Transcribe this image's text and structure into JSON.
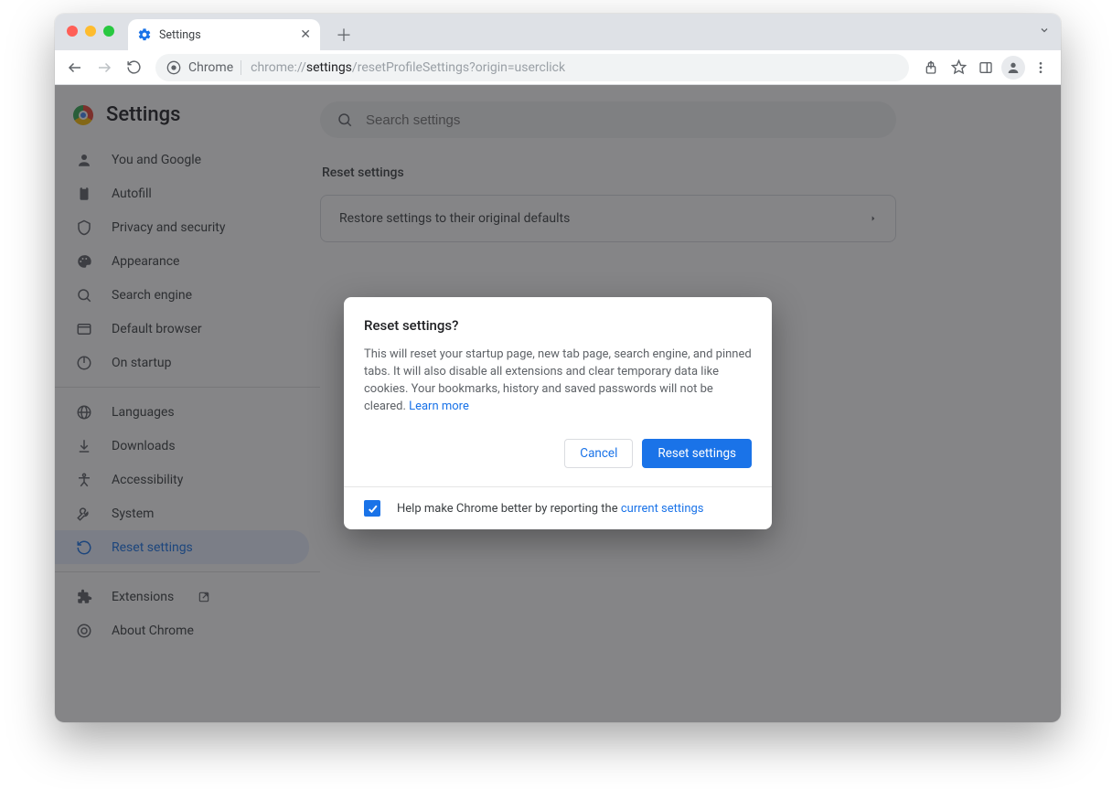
{
  "browser": {
    "tab_title": "Settings",
    "url_prefix": "Chrome",
    "url_scheme": "chrome://",
    "url_bold": "settings",
    "url_rest": "/resetProfileSettings?origin=userclick"
  },
  "sidebar": {
    "title": "Settings",
    "items": [
      {
        "label": "You and Google"
      },
      {
        "label": "Autofill"
      },
      {
        "label": "Privacy and security"
      },
      {
        "label": "Appearance"
      },
      {
        "label": "Search engine"
      },
      {
        "label": "Default browser"
      },
      {
        "label": "On startup"
      }
    ],
    "items2": [
      {
        "label": "Languages"
      },
      {
        "label": "Downloads"
      },
      {
        "label": "Accessibility"
      },
      {
        "label": "System"
      },
      {
        "label": "Reset settings"
      }
    ],
    "items3": [
      {
        "label": "Extensions"
      },
      {
        "label": "About Chrome"
      }
    ]
  },
  "main": {
    "search_placeholder": "Search settings",
    "section_title": "Reset settings",
    "option_label": "Restore settings to their original defaults"
  },
  "dialog": {
    "title": "Reset settings?",
    "body": "This will reset your startup page, new tab page, search engine, and pinned tabs. It will also disable all extensions and clear temporary data like cookies. Your bookmarks, history and saved passwords will not be cleared. ",
    "learn_more": "Learn more",
    "cancel": "Cancel",
    "confirm": "Reset settings",
    "footer_text": "Help make Chrome better by reporting the ",
    "footer_link": "current settings"
  }
}
